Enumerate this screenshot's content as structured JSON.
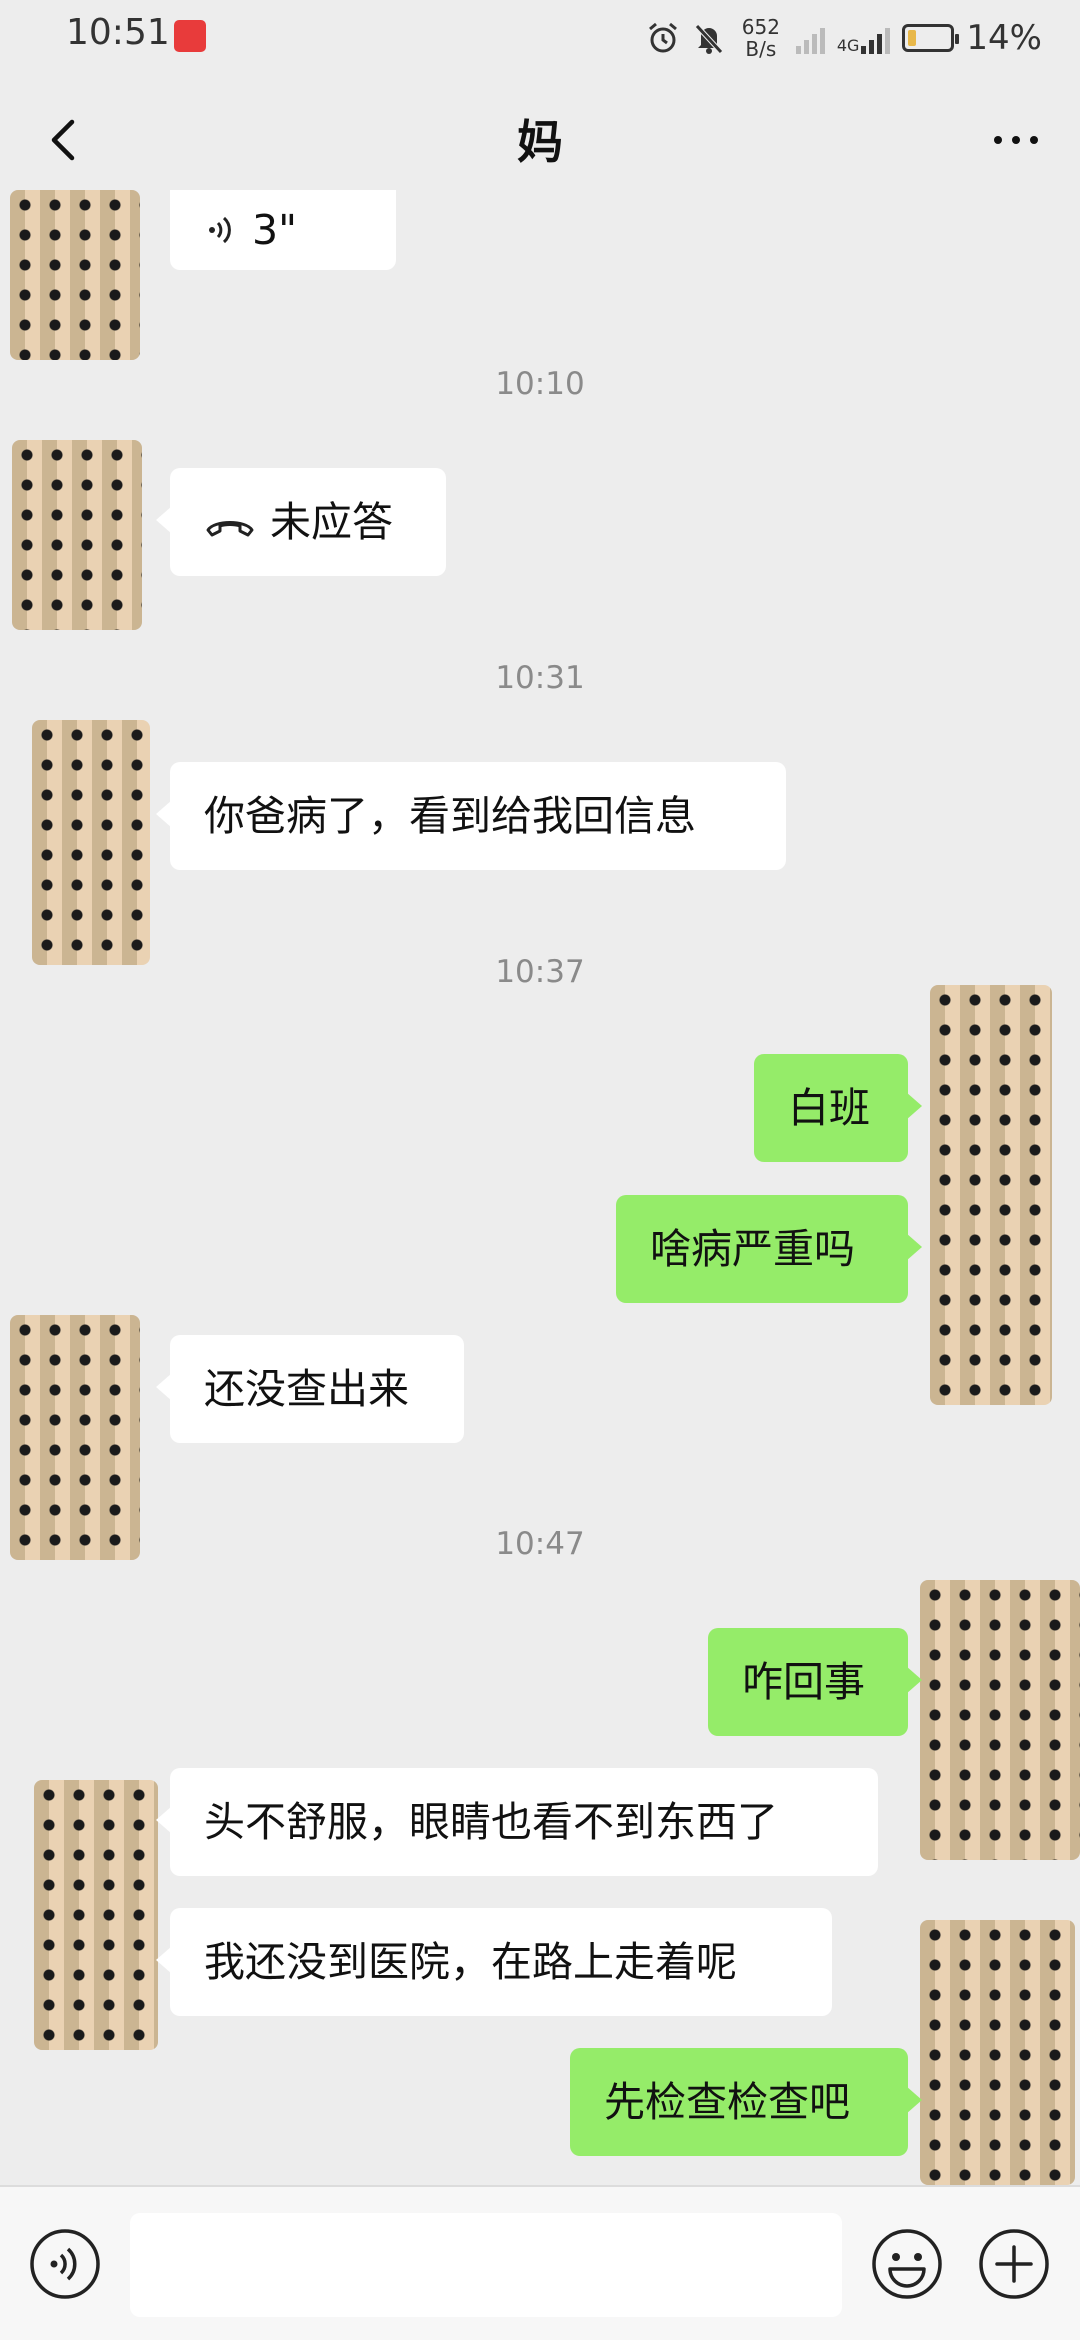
{
  "status_bar": {
    "time": "10:51",
    "net_speed_value": "652",
    "net_speed_unit": "B/s",
    "battery": "14%",
    "network_label": "4G"
  },
  "header": {
    "title": "妈"
  },
  "chat": {
    "partial_voice_duration": "3\"",
    "timestamps": [
      "10:10",
      "10:31",
      "10:37",
      "10:47"
    ],
    "missed_call_text": "未应答",
    "messages": [
      {
        "side": "left",
        "text": "你爸病了，看到给我回信息"
      },
      {
        "side": "right",
        "text": "白班"
      },
      {
        "side": "right",
        "text": "啥病严重吗"
      },
      {
        "side": "left",
        "text": "还没查出来"
      },
      {
        "side": "right",
        "text": "咋回事"
      },
      {
        "side": "left",
        "text": "头不舒服，眼睛也看不到东西了"
      },
      {
        "side": "left",
        "text": "我还没到医院，在路上走着呢"
      },
      {
        "side": "right",
        "text": "先检查检查吧"
      }
    ]
  },
  "colors": {
    "background": "#ededed",
    "incoming_bubble": "#ffffff",
    "outgoing_bubble": "#95ec69",
    "timestamp_text": "#8a8a8a"
  },
  "icons": {
    "back": "chevron-left-icon",
    "more": "more-dots-icon",
    "voice": "voice-icon",
    "emoji": "emoji-icon",
    "plus": "plus-icon",
    "call": "phone-hangup-icon"
  }
}
